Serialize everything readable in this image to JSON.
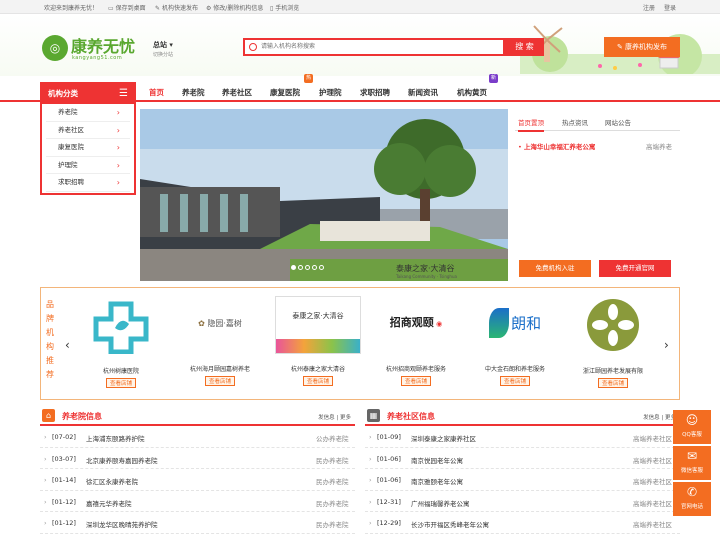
{
  "topbar": {
    "welcome": "欢迎来到康养无忧！",
    "desktop": "保存到桌面",
    "publish": "机构快速发布",
    "edit": "修改/删除机构信息",
    "mobile": "手机浏览",
    "register": "注册",
    "login": "登录"
  },
  "header": {
    "logo_mark": "◎",
    "logo_text": "康养无忧",
    "logo_url": "kangyang51.com",
    "site": "总站",
    "site_switch": "切换分站",
    "search_placeholder": "请输入机构名称搜索",
    "search_btn": "搜 索",
    "publish_btn": "康养机构发布"
  },
  "nav": {
    "items": [
      "首页",
      "养老院",
      "养老社区",
      "康复医院",
      "护理院",
      "求职招聘",
      "新闻资讯",
      "机构黄页"
    ],
    "badges": [
      "热",
      "新"
    ]
  },
  "category": {
    "title": "机构分类",
    "items": [
      "养老院",
      "养老社区",
      "康复医院",
      "护理院",
      "求职招聘"
    ]
  },
  "banner": {
    "caption": "泰康之家·大清谷",
    "caption_en": "Taikang Community · Tsinghua"
  },
  "rpanel": {
    "tabs": [
      "首页置顶",
      "热点资讯",
      "网站公告"
    ],
    "news": "上海华山幸福汇养老公寓",
    "news_tag": "高端养老",
    "btn1": "免费机构入驻",
    "btn2": "免费开通官网"
  },
  "brand": {
    "label": [
      "品",
      "牌",
      "机",
      "构",
      "推",
      "荐"
    ],
    "prev": "‹",
    "next": "›",
    "items": [
      {
        "logo_text": "",
        "name": "杭州树康医院",
        "tag": "查看店铺"
      },
      {
        "logo_text": "隐园·嘉树",
        "name": "杭州海月颐园嘉树养老",
        "tag": "查看店铺"
      },
      {
        "logo_text": "泰康之家·大清谷",
        "name": "杭州泰康之家大清谷",
        "tag": "查看店铺"
      },
      {
        "logo_text": "招商观颐",
        "name": "杭州招商观颐养老服务",
        "tag": "查看店铺"
      },
      {
        "logo_text": "朗和",
        "name": "中大金石朗和养老服务",
        "tag": "查看店铺"
      },
      {
        "logo_text": "",
        "name": "浙江颐园养老发展有限",
        "tag": "查看店铺"
      }
    ]
  },
  "sec1": {
    "title": "养老院信息",
    "more": "发信息 | 更多",
    "rows": [
      {
        "date": "[07-02]",
        "name": "上海浦东颐路养护院",
        "type": "公办养老院"
      },
      {
        "date": "[03-07]",
        "name": "北京康养颐寿嘉园养老院",
        "type": "民办养老院"
      },
      {
        "date": "[01-14]",
        "name": "徐汇区永康养老院",
        "type": "民办养老院"
      },
      {
        "date": "[01-12]",
        "name": "嘉禧元华养老院",
        "type": "民办养老院"
      },
      {
        "date": "[01-12]",
        "name": "深圳龙华区晚晴苑养护院",
        "type": "民办养老院"
      }
    ]
  },
  "sec2": {
    "title": "养老社区信息",
    "more": "发信息 | 更多",
    "rows": [
      {
        "date": "[01-09]",
        "name": "深圳泰康之家康养社区",
        "type": "高端养老社区"
      },
      {
        "date": "[01-06]",
        "name": "南京悦园老年公寓",
        "type": "高端养老社区"
      },
      {
        "date": "[01-06]",
        "name": "南京雅颐老年公寓",
        "type": "高端养老社区"
      },
      {
        "date": "[12-31]",
        "name": "广州福瑞馨养老公寓",
        "type": "高端养老社区"
      },
      {
        "date": "[12-29]",
        "name": "长沙市开福区秀峰老年公寓",
        "type": "高端养老社区"
      }
    ]
  },
  "sidebar": {
    "qq": "QQ客服",
    "wechat": "微信客服",
    "phone": "官网电话"
  },
  "colors": {
    "accent": "#e33333",
    "orange": "#f36d21",
    "green": "#5aa830"
  }
}
